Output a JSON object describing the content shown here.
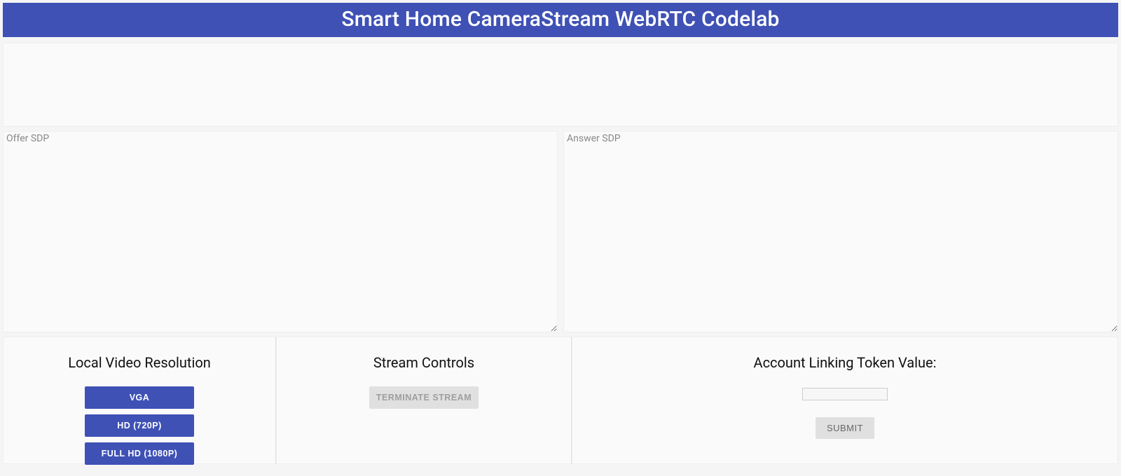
{
  "header": {
    "title": "Smart Home CameraStream WebRTC Codelab"
  },
  "sdp": {
    "offer_placeholder": "Offer SDP",
    "answer_placeholder": "Answer SDP",
    "offer_value": "",
    "answer_value": ""
  },
  "resolution": {
    "title": "Local Video Resolution",
    "buttons": [
      "VGA",
      "HD (720P)",
      "FULL HD (1080P)"
    ]
  },
  "stream_controls": {
    "title": "Stream Controls",
    "terminate_label": "TERMINATE STREAM"
  },
  "account_linking": {
    "title": "Account Linking Token Value:",
    "token_value": "",
    "submit_label": "SUBMIT"
  }
}
